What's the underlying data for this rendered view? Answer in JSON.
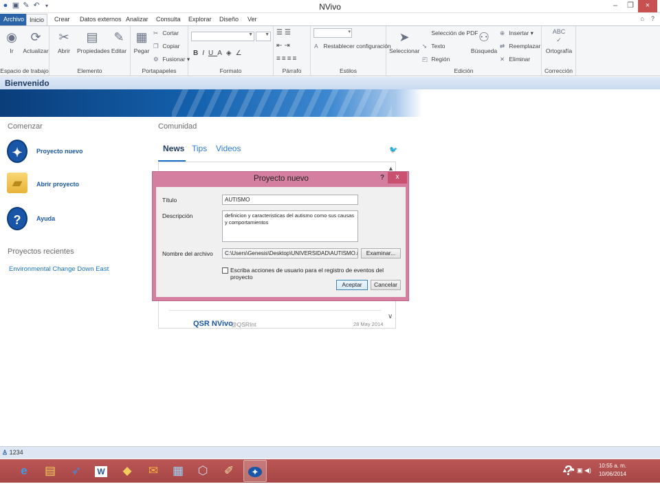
{
  "app": {
    "title": "NVivo"
  },
  "quick_access": [
    "app-logo-icon",
    "save-icon",
    "edit-pen-icon",
    "undo-icon",
    "customize-icon"
  ],
  "tabs": [
    {
      "label": "Archivo"
    },
    {
      "label": "Inicio"
    },
    {
      "label": "Crear"
    },
    {
      "label": "Datos externos"
    },
    {
      "label": "Analizar"
    },
    {
      "label": "Consulta"
    },
    {
      "label": "Explorar"
    },
    {
      "label": "Diseño"
    },
    {
      "label": "Ver"
    }
  ],
  "ribbon": {
    "groups": {
      "workspace": "Espacio de trabajo",
      "item": "Elemento",
      "clipboard": "Portapapeles",
      "format": "Formato",
      "paragraph": "Párrafo",
      "styles": "Estilos",
      "edit": "Edición",
      "correction": "Corrección"
    },
    "buttons": {
      "go": "Ir",
      "refresh": "Actualizar",
      "open": "Abrir",
      "properties": "Propiedades",
      "edit": "Editar",
      "paste": "Pegar",
      "cut": "Cortar",
      "copy": "Copiar",
      "merge": "Fusionar",
      "reset": "Restablecer configuración",
      "select": "Seleccionar",
      "select_pdf": "Selección de PDF",
      "text": "Texto",
      "region": "Región",
      "search": "Búsqueda",
      "insert": "Insertar",
      "replace": "Reemplazar",
      "delete": "Eliminar",
      "spelling": "Ortografía"
    },
    "spelling_badge": "ABC"
  },
  "welcome": {
    "title": "Bienvenido"
  },
  "start": {
    "title": "Comenzar",
    "items": [
      {
        "label": "Proyecto nuevo"
      },
      {
        "label": "Abrir proyecto"
      },
      {
        "label": "Ayuda"
      }
    ]
  },
  "recent": {
    "title": "Proyectos recientes",
    "items": [
      "Environmental Change Down East"
    ]
  },
  "community": {
    "title": "Comunidad",
    "tabs": [
      "News",
      "Tips",
      "Videos"
    ],
    "news": {
      "author": "QSR NVivo",
      "handle": "@QSRInt",
      "date": "28 May 2014"
    }
  },
  "dialog": {
    "title": "Proyecto nuevo",
    "help": "?",
    "close": "x",
    "title_label": "Título",
    "title_value": "AUTISMO",
    "description_label": "Descripción",
    "description_value": "definicion y caracteristicas del autismo como sus causas y comportamientos",
    "filename_label": "Nombre del archivo",
    "filename_value": "C:\\Users\\Genesis\\Desktop\\UNIVERSIDAD\\AUTISMO.nvp",
    "browse": "Examinar...",
    "log_checkbox": "Escriba acciones de usuario para el registro de eventos del proyecto",
    "log_checked": false,
    "accept": "Aceptar",
    "cancel": "Cancelar"
  },
  "status": {
    "user": "1234"
  },
  "taskbar": {
    "clock_time": "10:55 a. m.",
    "clock_date": "10/06/2014",
    "apps": [
      "internet-explorer-icon",
      "file-explorer-icon",
      "rocket-app-icon",
      "word-icon",
      "folder-icon",
      "outlook-icon",
      "control-panel-icon",
      "virtualbox-icon",
      "paint-icon",
      "nvivo-icon"
    ]
  },
  "colors": {
    "accent": "#2a63a8",
    "dialog_frame": "#d57fa0",
    "taskbar": "#b05050",
    "link": "#1a73c8"
  }
}
